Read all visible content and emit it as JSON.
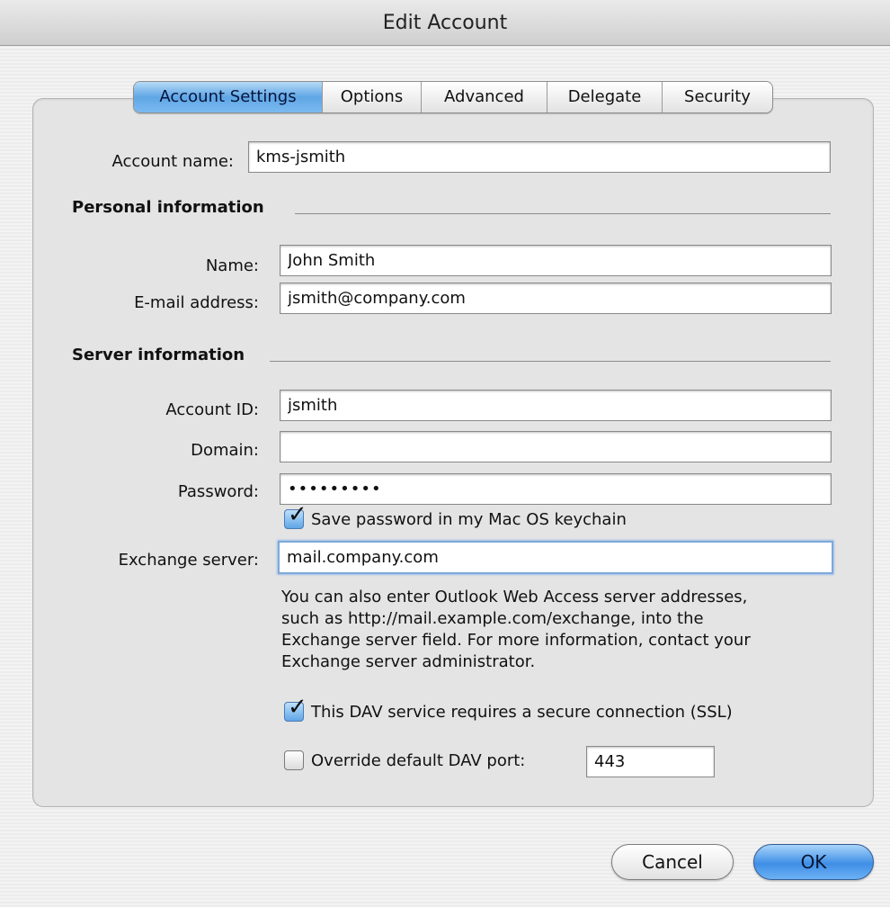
{
  "window": {
    "title": "Edit Account"
  },
  "tabs": [
    {
      "label": "Account Settings",
      "active": true
    },
    {
      "label": "Options",
      "active": false
    },
    {
      "label": "Advanced",
      "active": false
    },
    {
      "label": "Delegate",
      "active": false
    },
    {
      "label": "Security",
      "active": false
    }
  ],
  "account": {
    "label": "Account name:",
    "value": "kms-jsmith"
  },
  "personal": {
    "heading": "Personal information",
    "name_label": "Name:",
    "name_value": "John Smith",
    "email_label": "E-mail address:",
    "email_value": "jsmith@company.com"
  },
  "server": {
    "heading": "Server information",
    "account_id_label": "Account ID:",
    "account_id_value": "jsmith",
    "domain_label": "Domain:",
    "domain_value": "",
    "password_label": "Password:",
    "password_value": "•••••••••",
    "save_password_label": "Save password in my Mac OS keychain",
    "save_password_checked": true,
    "exchange_label": "Exchange server:",
    "exchange_value": "mail.company.com",
    "help_lines": [
      "You can also enter Outlook Web Access server addresses,",
      "such as http://mail.example.com/exchange, into the",
      "Exchange server field. For more information, contact your",
      "Exchange server administrator."
    ],
    "ssl_label": "This DAV service requires a secure connection (SSL)",
    "ssl_checked": true,
    "override_label": "Override default DAV port:",
    "override_checked": false,
    "port_value": "443"
  },
  "buttons": {
    "cancel": "Cancel",
    "ok": "OK"
  },
  "colors": {
    "accent": "#5fa6e6",
    "panel": "#e4e4e4"
  }
}
